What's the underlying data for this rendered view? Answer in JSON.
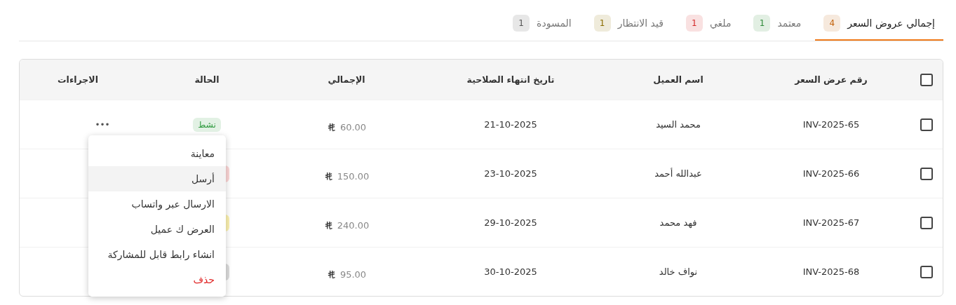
{
  "tabs": [
    {
      "label": "إجمالي عروض السعر",
      "count": "4",
      "color": "#c2620a",
      "selected": true
    },
    {
      "label": "معتمد",
      "count": "1",
      "color": "#2f8a3a",
      "selected": false
    },
    {
      "label": "ملغي",
      "count": "1",
      "color": "#d42a2a",
      "selected": false
    },
    {
      "label": "قيد الانتظار",
      "count": "1",
      "color": "#8a6d00",
      "selected": false
    },
    {
      "label": "المسودة",
      "count": "1",
      "color": "#555555",
      "selected": false
    }
  ],
  "table": {
    "select_all": {
      "checked": false
    },
    "columns": [
      "رقم عرض السعر",
      "اسم العميل",
      "تاريخ انتهاء الصلاحية",
      "الإجمالي",
      "الحالة",
      "الاجراءات"
    ],
    "rows": [
      {
        "checked": false,
        "number": "INV-2025-65",
        "customer": "محمد السيد",
        "expiry": "21-10-2025",
        "total": "60.00",
        "status": {
          "label": "نشط",
          "color": "#2e9a3e"
        },
        "actions": "•••"
      },
      {
        "checked": false,
        "number": "INV-2025-66",
        "customer": "عبدالله أحمد",
        "expiry": "23-10-2025",
        "total": "150.00",
        "status": {
          "color": "#fbd5d5"
        }
      },
      {
        "checked": false,
        "number": "INV-2025-67",
        "customer": "فهد محمد",
        "expiry": "29-10-2025",
        "total": "240.00",
        "status": {
          "color": "#fbf1b0"
        }
      },
      {
        "checked": false,
        "number": "INV-2025-68",
        "customer": "نواف خالد",
        "expiry": "30-10-2025",
        "total": "95.00",
        "status": {
          "color": "#dcdcdc"
        }
      }
    ]
  },
  "menu": {
    "items": [
      {
        "label": "معاينة",
        "kind": "normal",
        "selected": false
      },
      {
        "label": "أرسل",
        "kind": "normal",
        "selected": true
      },
      {
        "label": "الارسال عبر واتساب",
        "kind": "normal",
        "selected": false
      },
      {
        "label": "العرض ك عميل",
        "kind": "normal",
        "selected": false
      },
      {
        "label": "انشاء رابط قابل للمشاركة",
        "kind": "normal",
        "selected": false
      },
      {
        "label": "حذف",
        "kind": "danger",
        "selected": false
      }
    ]
  }
}
